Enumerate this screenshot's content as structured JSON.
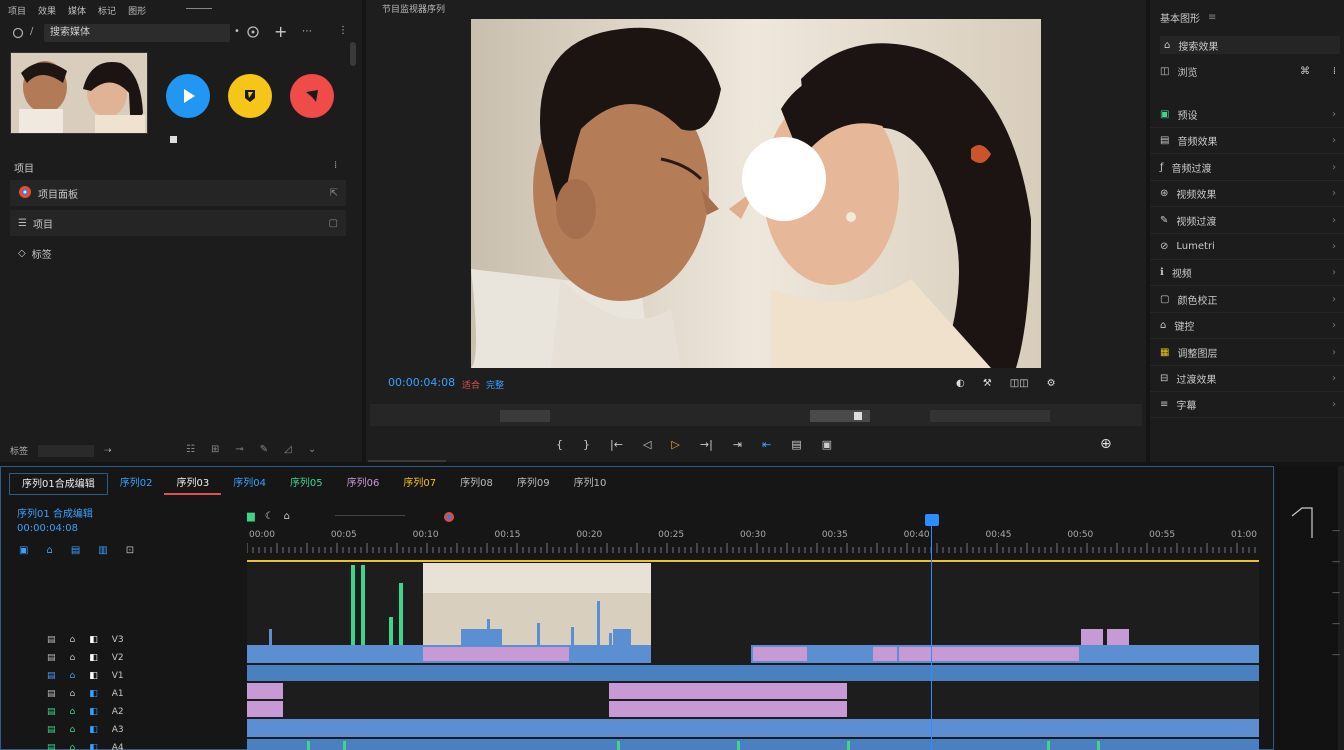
{
  "left_panel": {
    "menu": [
      "项目",
      "效果",
      "媒体",
      "标记",
      "图形"
    ],
    "search_value": "搜索媒体",
    "list_header": "项目",
    "items": [
      {
        "label": "项目面板",
        "icon": "chrome-icon"
      },
      {
        "label": "项目",
        "icon": "list-icon"
      },
      {
        "label": "标签",
        "icon": "tag-icon"
      }
    ],
    "bottom_label": "标签"
  },
  "viewer": {
    "title": "节目监视器序列",
    "timecode": "00:00:04:08",
    "fit_label": "适合",
    "quality_label": "完整",
    "controls": [
      "{",
      "}",
      "|←",
      "◁",
      "▷",
      "→|",
      "⇥",
      "⇤",
      "▤",
      "▣",
      "⊕"
    ]
  },
  "right_panel": {
    "header": "基本图形",
    "search": "搜索效果",
    "section": "浏览",
    "items": [
      "预设",
      "音频效果",
      "音频过渡",
      "视频效果",
      "视频过渡",
      "Lumetri",
      "视频",
      "颜色校正",
      "键控",
      "调整图层",
      "过渡效果",
      "字幕"
    ]
  },
  "timeline": {
    "tabs": [
      "序列01合成编辑",
      "序列02",
      "序列03",
      "序列04",
      "序列05",
      "序列06",
      "序列07",
      "序列08",
      "序列09",
      "序列10"
    ],
    "header_title": "序列01 合成编辑",
    "header_timecode": "00:00:04:08",
    "ruler_labels": [
      "00:00",
      "00:05",
      "00:10",
      "00:15",
      "00:20",
      "00:25",
      "00:30",
      "00:35",
      "00:40",
      "00:45",
      "00:50",
      "00:55",
      "01:00"
    ],
    "tracks": [
      "V3",
      "V2",
      "V1",
      "A1",
      "A2",
      "A3",
      "A4"
    ]
  },
  "colors": {
    "accent": "#2d8cff",
    "clip_blue": "#5b8fd1",
    "clip_pink": "#c79ad6",
    "clip_green": "#3fd48a",
    "playhead": "#2d8cff",
    "yellow_bar": "#f1c21b"
  }
}
